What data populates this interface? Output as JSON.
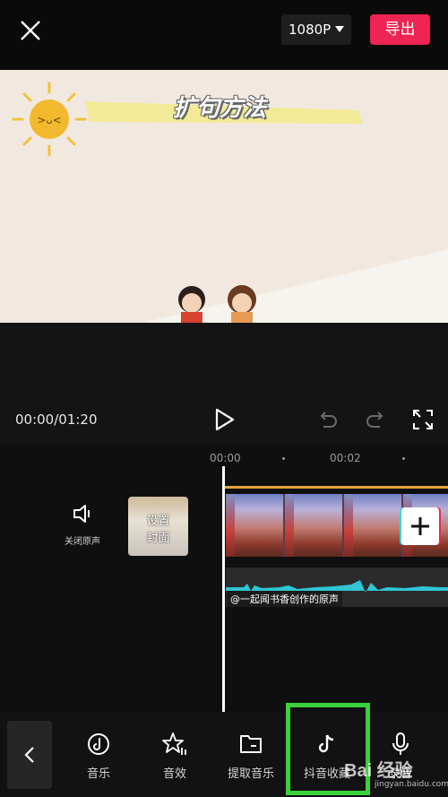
{
  "top_bar": {
    "resolution": "1080P",
    "export_label": "导出"
  },
  "preview": {
    "title": "扩句方法"
  },
  "playback": {
    "timecode": "00:00/01:20"
  },
  "timeline": {
    "ruler": [
      "00:00",
      "00:02"
    ],
    "mute_label": "关闭原声",
    "cover_label_line1": "设置",
    "cover_label_line2": "封面",
    "audio_label": "@一起闻书香创作的原声"
  },
  "toolbar": {
    "items": [
      {
        "label": "音乐",
        "icon": "music-disc-icon"
      },
      {
        "label": "音效",
        "icon": "star-sound-icon"
      },
      {
        "label": "提取音乐",
        "icon": "folder-icon"
      },
      {
        "label": "抖音收藏",
        "icon": "douyin-icon"
      },
      {
        "label": "录音",
        "icon": "microphone-icon"
      }
    ]
  },
  "watermark": {
    "brand": "Bai  经验",
    "url": "jingyan.baidu.com"
  },
  "colors": {
    "accent": "#ee2452",
    "highlight": "#3bd13b",
    "audio_wave": "#2fc6d4"
  }
}
